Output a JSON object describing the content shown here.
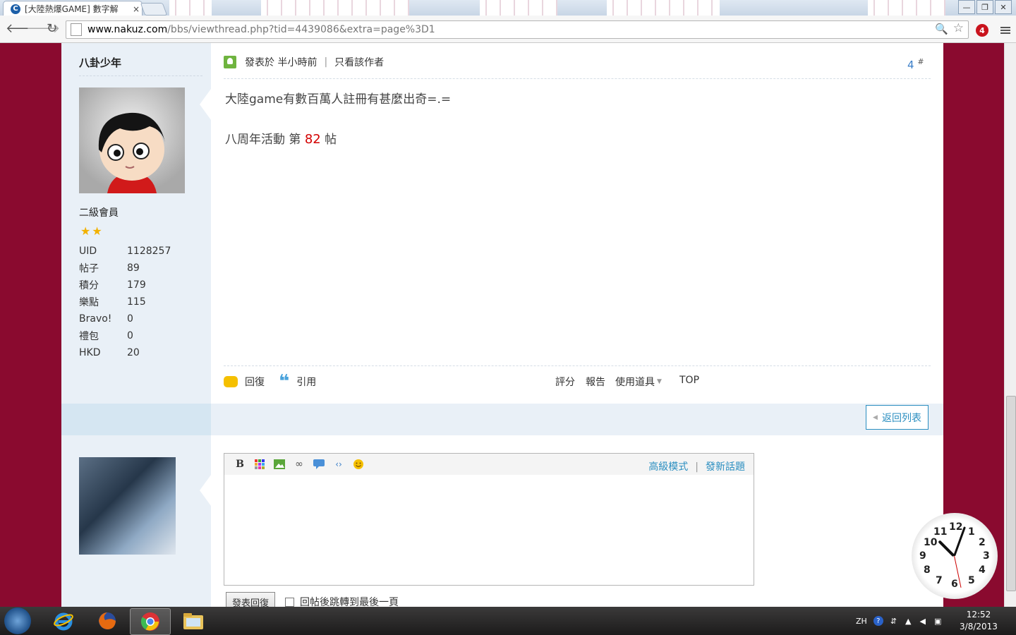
{
  "browser": {
    "tab_title": "[大陸熱爆GAME] 數字解",
    "tab_favicon": "C",
    "close": "×",
    "url_host": "www.nakuz.com",
    "url_path": "/bbs/viewthread.php?tid=4439086&extra=page%3D1",
    "extension_badge": "4"
  },
  "post": {
    "author": "八卦少年",
    "rank": "二級會員",
    "stars": "★★",
    "stats": [
      {
        "k": "UID",
        "v": "1128257"
      },
      {
        "k": "帖子",
        "v": "89"
      },
      {
        "k": "積分",
        "v": "179"
      },
      {
        "k": "樂點",
        "v": "115"
      },
      {
        "k": "Bravo!",
        "v": "0"
      },
      {
        "k": "禮包",
        "v": "0"
      },
      {
        "k": "HKD",
        "v": "20"
      }
    ],
    "posted_at": "發表於 半小時前",
    "author_only": "只看該作者",
    "floor": "4",
    "floor_mark": "#",
    "body_line1": "大陸game有數百萬人註冊有甚麼出奇=.=",
    "body_line2_prefix": "八周年活動 第 ",
    "body_line2_num": "82",
    "body_line2_suffix": " 帖",
    "reply": "回復",
    "quote": "引用",
    "rate": "評分",
    "report": "報告",
    "use_tool": "使用道具",
    "top": "TOP",
    "pipe": "|"
  },
  "thread": {
    "back_to_list": "返回列表"
  },
  "editor": {
    "bold": "B",
    "advanced_mode": "高級模式",
    "new_topic": "發新話題",
    "pipe": "|",
    "submit": "發表回復",
    "jump_last": "回帖後跳轉到最後一頁"
  },
  "clock": {
    "numbers": [
      "12",
      "1",
      "2",
      "3",
      "4",
      "5",
      "6",
      "7",
      "8",
      "9",
      "10",
      "11"
    ]
  },
  "taskbar": {
    "lang": "ZH",
    "time": "12:52",
    "date": "3/8/2013"
  }
}
